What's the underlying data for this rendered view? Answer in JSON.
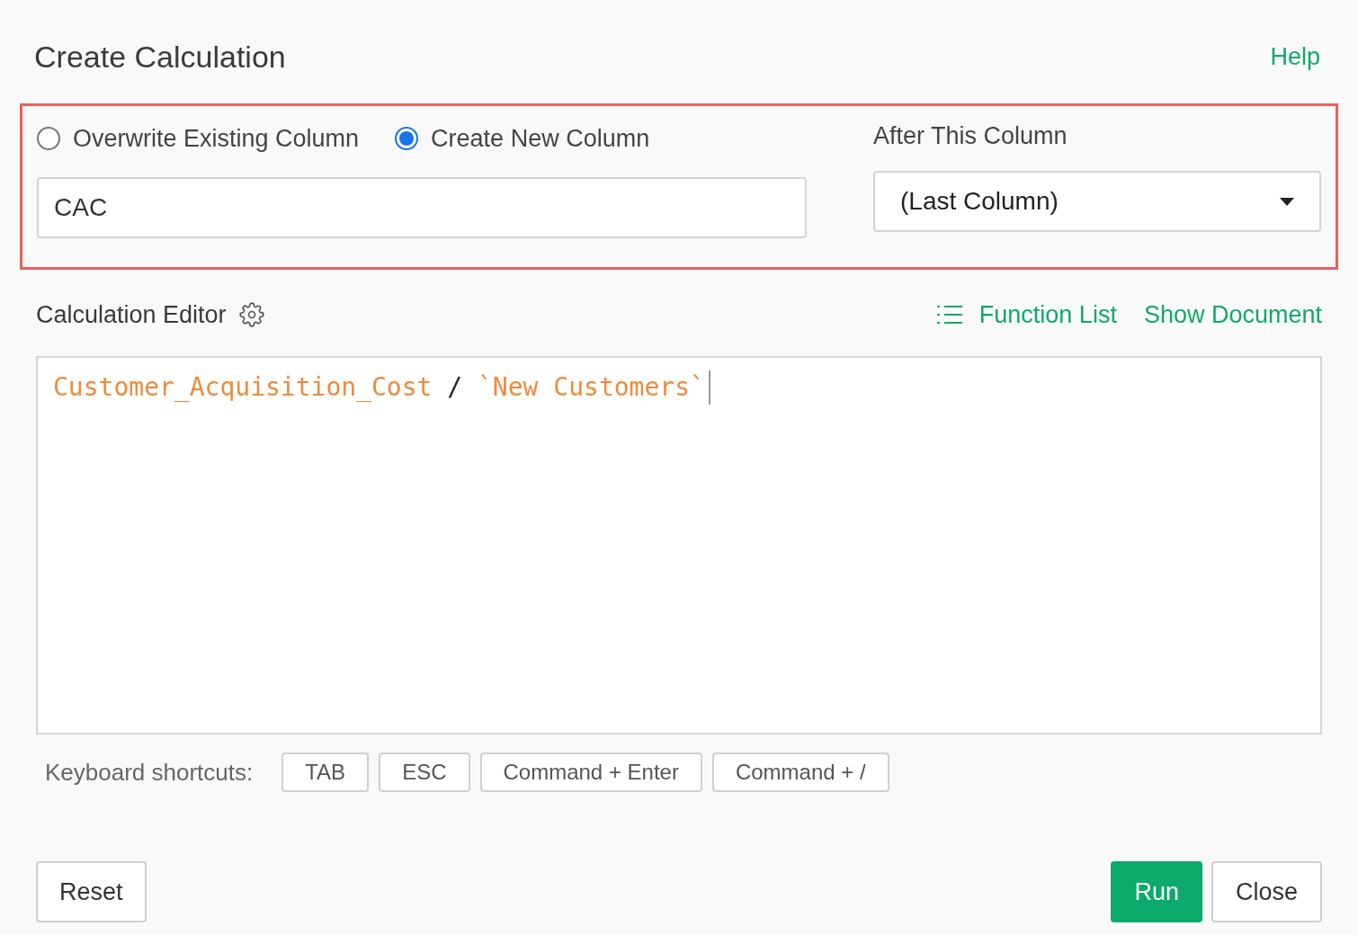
{
  "dialog": {
    "title": "Create Calculation",
    "help_link": "Help"
  },
  "target": {
    "options": [
      {
        "label": "Overwrite Existing Column",
        "selected": false
      },
      {
        "label": "Create New Column",
        "selected": true
      }
    ],
    "column_name": {
      "value": "CAC"
    },
    "position": {
      "label": "After This Column",
      "value": "(Last Column)"
    }
  },
  "editor": {
    "title": "Calculation Editor",
    "links": [
      "Function List",
      "Show Document"
    ],
    "tokens": [
      {
        "kind": "column",
        "text": "Customer_Acquisition_Cost"
      },
      {
        "kind": "operator",
        "text": " / "
      },
      {
        "kind": "column",
        "text": "`New Customers`"
      }
    ]
  },
  "shortcuts": {
    "label": "Keyboard shortcuts:",
    "keys": [
      "TAB",
      "ESC",
      "Command + Enter",
      "Command + /"
    ]
  },
  "buttons": {
    "reset": "Reset",
    "run": "Run",
    "close": "Close"
  }
}
